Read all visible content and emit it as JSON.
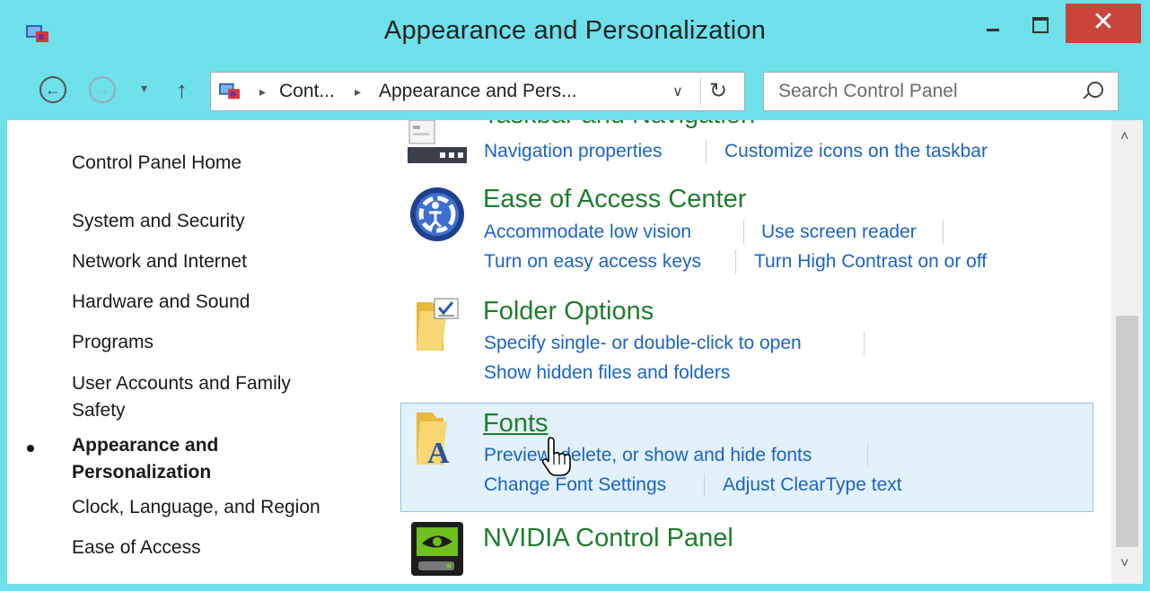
{
  "window": {
    "title": "Appearance and Personalization",
    "close_glyph": "✕"
  },
  "nav": {
    "back_glyph": "←",
    "forward_glyph": "→",
    "recent_glyph": "▾",
    "up_glyph": "↑",
    "breadcrumbs": [
      "Cont...",
      "Appearance and Pers..."
    ],
    "crumb_sep": "▸",
    "dropdown_glyph": "∨",
    "refresh_glyph": "↻",
    "search_placeholder": "Search Control Panel"
  },
  "sidebar": {
    "items": [
      "Control Panel Home",
      "System and Security",
      "Network and Internet",
      "Hardware and Sound",
      "Programs",
      "User Accounts and Family Safety",
      "Appearance and Personalization",
      "Clock, Language, and Region",
      "Ease of Access"
    ],
    "active_item": "Appearance and Personalization"
  },
  "categories": {
    "taskbar": {
      "title": "Taskbar and Navigation",
      "links": [
        "Navigation properties",
        "Customize icons on the taskbar"
      ]
    },
    "ease": {
      "title": "Ease of Access Center",
      "links": [
        "Accommodate low vision",
        "Use screen reader",
        "Turn on easy access keys",
        "Turn High Contrast on or off"
      ]
    },
    "folder": {
      "title": "Folder Options",
      "links": [
        "Specify single- or double-click to open",
        "Show hidden files and folders"
      ]
    },
    "fonts": {
      "title": "Fonts",
      "links": [
        "Preview, delete, or show and hide fonts",
        "Change Font Settings",
        "Adjust ClearType text"
      ]
    },
    "nvidia": {
      "title": "NVIDIA Control Panel"
    }
  },
  "scrollbar": {
    "up_glyph": "˄",
    "down_glyph": "˅"
  },
  "colors": {
    "titlebar": "#6ee0ea",
    "close_button": "#c9443a",
    "category_title": "#1e7d2e",
    "link": "#1b63c5",
    "hover_bg": "#e3f1fb"
  }
}
